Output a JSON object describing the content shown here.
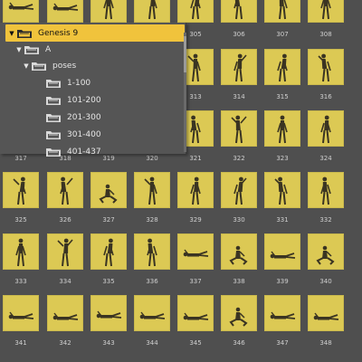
{
  "tree": {
    "items": [
      {
        "label": "Genesis 9",
        "arrow": "▼",
        "selected": true
      },
      {
        "label": "A",
        "arrow": "▼",
        "selected": false
      },
      {
        "label": "poses",
        "arrow": "▼",
        "selected": false
      },
      {
        "label": "1-100",
        "arrow": "",
        "selected": false
      },
      {
        "label": "101-200",
        "arrow": "",
        "selected": false
      },
      {
        "label": "201-300",
        "arrow": "",
        "selected": false
      },
      {
        "label": "301-400",
        "arrow": "",
        "selected": false
      },
      {
        "label": "401-437",
        "arrow": "",
        "selected": false
      }
    ]
  },
  "grid": {
    "rows": [
      {
        "labels": [
          "",
          "",
          "",
          "",
          "305",
          "306",
          "307",
          "308"
        ],
        "figures": [
          "lying",
          "lying",
          "standing",
          "standing",
          "standing",
          "standing",
          "standing",
          "standing"
        ]
      },
      {
        "labels": [
          "",
          "",
          "",
          "",
          "313",
          "314",
          "315",
          "316"
        ],
        "figures": [
          "",
          "",
          "",
          "",
          "standing",
          "standing",
          "standing",
          "standing"
        ]
      },
      {
        "labels": [
          "317",
          "318",
          "319",
          "320",
          "321",
          "322",
          "323",
          "324"
        ],
        "figures": [
          "",
          "",
          "",
          "standing",
          "standing",
          "standing",
          "standing",
          "standing"
        ]
      },
      {
        "labels": [
          "325",
          "326",
          "327",
          "328",
          "329",
          "330",
          "331",
          "332"
        ],
        "figures": [
          "standing",
          "standing",
          "sitting",
          "standing",
          "standing",
          "standing",
          "standing",
          "standing"
        ]
      },
      {
        "labels": [
          "333",
          "334",
          "335",
          "336",
          "337",
          "338",
          "339",
          "340"
        ],
        "figures": [
          "standing",
          "standing",
          "standing",
          "standing",
          "lying",
          "sitting",
          "lying",
          "sitting"
        ]
      },
      {
        "labels": [
          "341",
          "342",
          "343",
          "344",
          "345",
          "346",
          "347",
          "348"
        ],
        "figures": [
          "lying",
          "lying",
          "lying",
          "lying",
          "lying",
          "sitting",
          "lying",
          "lying"
        ]
      }
    ]
  },
  "colors": {
    "background": "#4f4f4f",
    "tile": "#dcc954",
    "figure": "#3a3422",
    "tree_background": "#555555",
    "tree_selected": "#f0c33c"
  }
}
